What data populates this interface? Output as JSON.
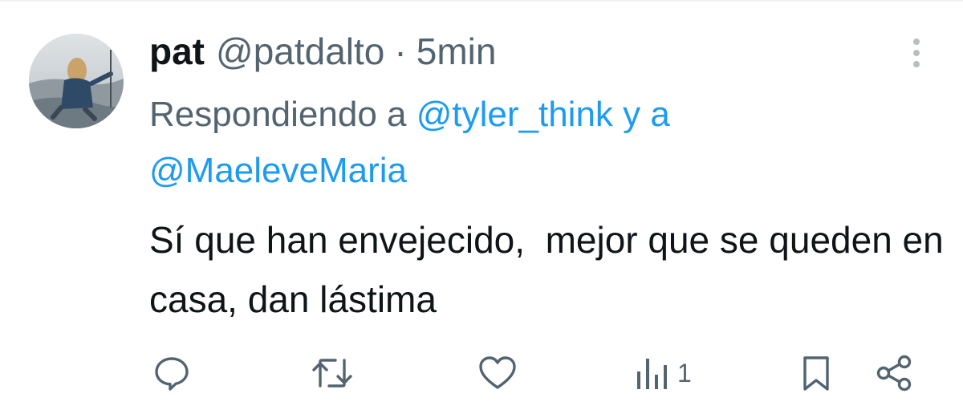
{
  "tweet": {
    "author": {
      "display_name": "pat",
      "handle": "@patdalto"
    },
    "separator": "·",
    "timestamp": "5min",
    "reply_context": {
      "prefix": "Respondiendo a",
      "mention_1": "@tyler_think",
      "conjunction": "y a",
      "mention_2": "@MaeleveMaria"
    },
    "text": "Sí que han envejecido,  mejor que se queden en casa, dan lástima",
    "actions": {
      "reply_icon": "reply-bubble-icon",
      "retweet_icon": "retweet-icon",
      "like_icon": "heart-icon",
      "views_icon": "views-bar-chart-icon",
      "views_count": "1",
      "bookmark_icon": "bookmark-icon",
      "share_icon": "share-icon"
    }
  },
  "colors": {
    "text_primary": "#0f1419",
    "text_secondary": "#536471",
    "accent": "#1d9bf0"
  }
}
